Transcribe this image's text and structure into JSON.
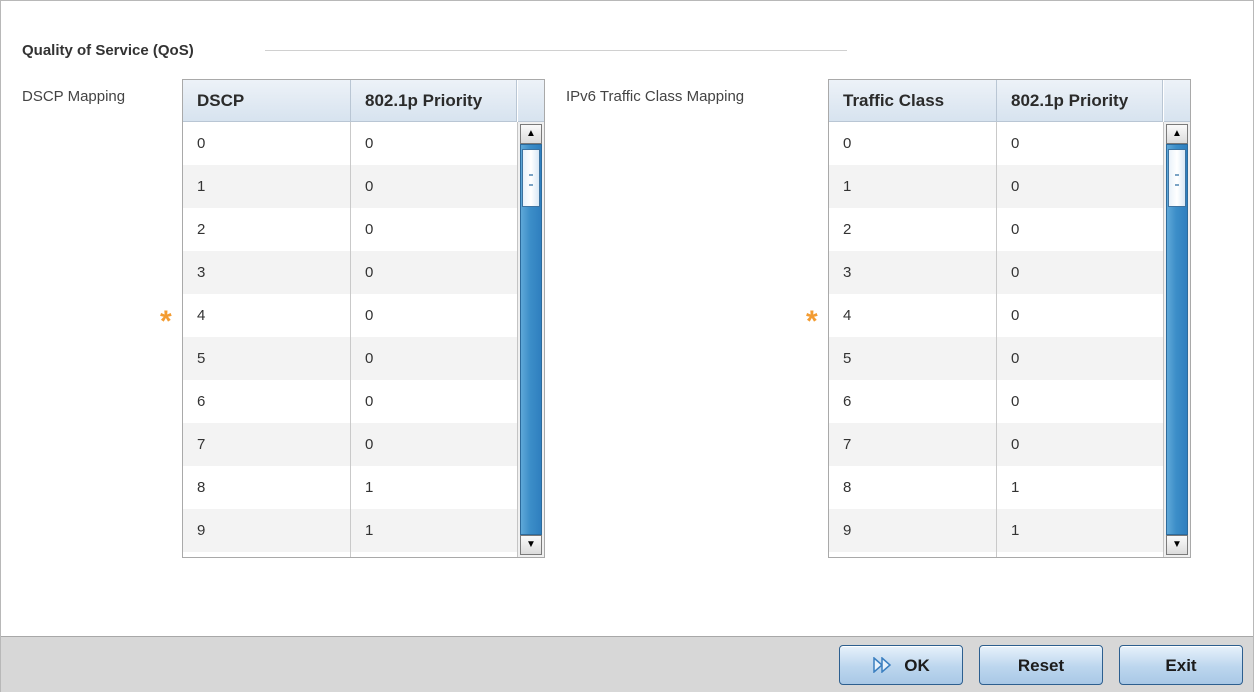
{
  "qos": {
    "section_title": "Quality of Service (QoS)",
    "dscp": {
      "label": "DSCP Mapping",
      "columns": [
        "DSCP",
        "802.1p Priority"
      ],
      "rows": [
        [
          "0",
          "0"
        ],
        [
          "1",
          "0"
        ],
        [
          "2",
          "0"
        ],
        [
          "3",
          "0"
        ],
        [
          "4",
          "0"
        ],
        [
          "5",
          "0"
        ],
        [
          "6",
          "0"
        ],
        [
          "7",
          "0"
        ],
        [
          "8",
          "1"
        ],
        [
          "9",
          "1"
        ]
      ]
    },
    "ipv6": {
      "label": "IPv6 Traffic Class Mapping",
      "columns": [
        "Traffic Class",
        "802.1p Priority"
      ],
      "rows": [
        [
          "0",
          "0"
        ],
        [
          "1",
          "0"
        ],
        [
          "2",
          "0"
        ],
        [
          "3",
          "0"
        ],
        [
          "4",
          "0"
        ],
        [
          "5",
          "0"
        ],
        [
          "6",
          "0"
        ],
        [
          "7",
          "0"
        ],
        [
          "8",
          "1"
        ],
        [
          "9",
          "1"
        ]
      ]
    },
    "required_marker": "*"
  },
  "footer": {
    "ok_label": "OK",
    "reset_label": "Reset",
    "exit_label": "Exit"
  },
  "colors": {
    "required_marker": "#f39c32",
    "scroll_track": "#3c8ec8",
    "button_border": "#2d5f8f"
  },
  "icons": {
    "ok_button_icon": "double-chevron-right-icon",
    "scroll_up": "arrow-up-icon",
    "scroll_down": "arrow-down-icon"
  }
}
